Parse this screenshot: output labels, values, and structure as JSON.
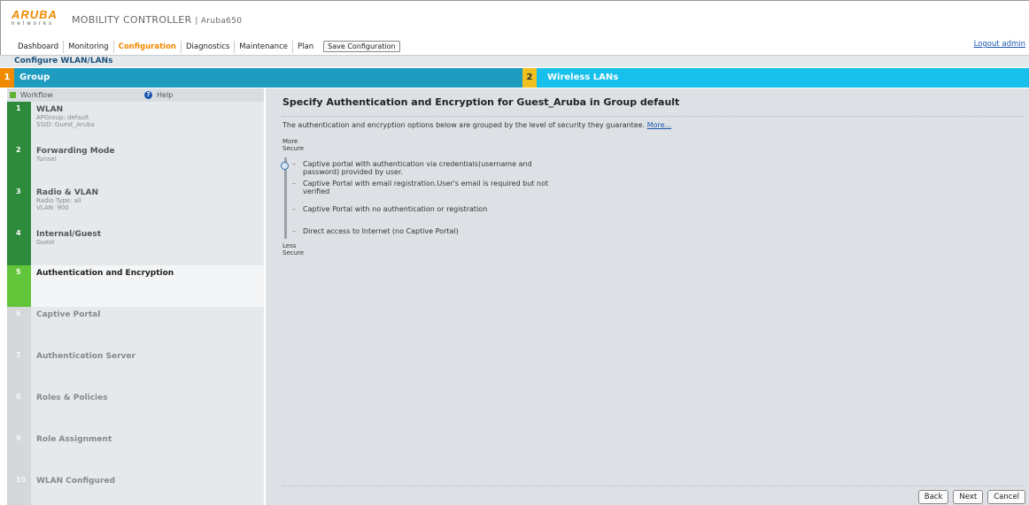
{
  "brand": {
    "logo_word": "ARUBA",
    "logo_sub": "networks",
    "product": "MOBILITY CONTROLLER",
    "controller": "| Aruba650"
  },
  "nav": {
    "items": [
      "Dashboard",
      "Monitoring",
      "Configuration",
      "Diagnostics",
      "Maintenance",
      "Plan"
    ],
    "active": "Configuration",
    "save_label": "Save Configuration",
    "logout_label": "Logout admin"
  },
  "page_title": "Configure WLAN/LANs",
  "steps": [
    {
      "num": "1",
      "label": "Group"
    },
    {
      "num": "2",
      "label": "Wireless LANs"
    }
  ],
  "sidebar": {
    "workflow_label": "Workflow",
    "help_label": "Help",
    "items": [
      {
        "num": "1",
        "title": "WLAN",
        "sub1": "APGroup: default",
        "sub2": "SSID: Guest_Aruba",
        "state": "done"
      },
      {
        "num": "2",
        "title": "Forwarding Mode",
        "sub1": "Tunnel",
        "sub2": "",
        "state": "done"
      },
      {
        "num": "3",
        "title": "Radio & VLAN",
        "sub1": "Radio Type: all",
        "sub2": "VLAN: 900",
        "state": "done"
      },
      {
        "num": "4",
        "title": "Internal/Guest",
        "sub1": "Guest",
        "sub2": "",
        "state": "done"
      },
      {
        "num": "5",
        "title": "Authentication and Encryption",
        "sub1": "",
        "sub2": "",
        "state": "current"
      },
      {
        "num": "6",
        "title": "Captive Portal",
        "sub1": "",
        "sub2": "",
        "state": "todo"
      },
      {
        "num": "7",
        "title": "Authentication Server",
        "sub1": "",
        "sub2": "",
        "state": "todo"
      },
      {
        "num": "8",
        "title": "Roles & Policies",
        "sub1": "",
        "sub2": "",
        "state": "todo"
      },
      {
        "num": "9",
        "title": "Role Assignment",
        "sub1": "",
        "sub2": "",
        "state": "todo"
      },
      {
        "num": "10",
        "title": "WLAN Configured",
        "sub1": "",
        "sub2": "",
        "state": "todo"
      }
    ]
  },
  "main": {
    "title": "Specify Authentication and Encryption for Guest_Aruba in Group default",
    "intro": "The authentication and encryption options below are grouped by the level of security they guarantee.",
    "more_link": "More...",
    "more_secure_1": "More",
    "more_secure_2": "Secure",
    "less_secure_1": "Less",
    "less_secure_2": "Secure",
    "options": [
      "Captive portal with authentication via credentials(username and password) provided by user.",
      "Captive Portal with email registration.User's email is required but not verified",
      "Captive Portal with no authentication or registration",
      "Direct access to Internet (no Captive Portal)"
    ],
    "selected_option_index": 0
  },
  "buttons": {
    "back": "Back",
    "next": "Next",
    "cancel": "Cancel"
  },
  "colors": {
    "accent_orange": "#f08a00",
    "step_blue": "#1f9dc1",
    "step_cyan": "#17c0ea",
    "done_green": "#2e8b3c",
    "current_green": "#62c53a",
    "link_blue": "#1a56b0"
  }
}
